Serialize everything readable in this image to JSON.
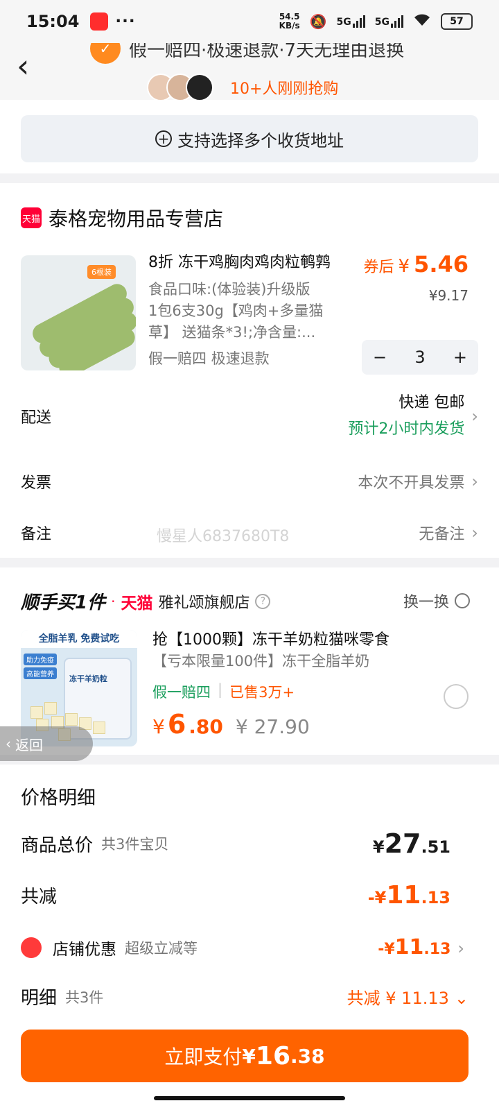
{
  "status_bar": {
    "time": "15:04",
    "speed_value": "54.5",
    "speed_unit": "KB/s",
    "net1": "5G",
    "net2": "5G",
    "battery": "57"
  },
  "header": {
    "guarantee_text": "假一赔四·极速退款·7天无理由退换",
    "buyers_text": "10+人刚刚抢购"
  },
  "address": {
    "multi_address_label": "支持选择多个收货地址"
  },
  "shop1": {
    "badge": "天猫",
    "name": "泰格宠物用品专营店",
    "product": {
      "thumb_tag": "6根装",
      "title": "8折 冻干鸡胸肉鸡肉粒鹌鹑",
      "desc_line1": "食品口味:(体验装)升级版",
      "desc_line2": "1包6支30g【鸡肉+多量猫",
      "desc_line3": "草】  送猫条*3!;净含量:...",
      "tags": "假一赔四  极速退款",
      "after_coupon_label": "券后",
      "currency": "¥",
      "after_coupon_price": "5.46",
      "original_price": "¥9.17",
      "quantity": "3",
      "minus": "−",
      "plus": "+"
    },
    "delivery": {
      "label": "配送",
      "method": "快递 包邮",
      "eta": "预计2小时内发货"
    },
    "invoice": {
      "label": "发票",
      "value": "本次不开具发票"
    },
    "remark": {
      "label": "备注",
      "value": "无备注"
    },
    "watermark": "慢星人6837680T8"
  },
  "shop2": {
    "brand": "顺手买1件",
    "dot": "·",
    "tmall": "天猫",
    "name": "雅礼颂旗舰店",
    "swap_label": "换一换",
    "product": {
      "thumb_top": "全脂羊乳 免费试吃",
      "thumb_tag1": "助力免疫",
      "thumb_tag2": "高能营养",
      "thumb_label": "冻干羊奶粒",
      "title": "抢【1000颗】冻干羊奶粒猫咪零食",
      "subtitle": "【亏本限量100件】冻干全脂羊奶",
      "tag1": "假一赔四",
      "tag2": "已售3万+",
      "currency": "¥",
      "price_int": "6",
      "price_dec": ".80",
      "original_price": "¥ 27.90"
    }
  },
  "return_tab": "返回",
  "price_detail": {
    "title": "价格明细",
    "total_label": "商品总价",
    "total_sub": "共3件宝贝",
    "total_currency": "¥",
    "total_int": "27",
    "total_dec": ".51",
    "reduce_label": "共减",
    "reduce_prefix": "-¥",
    "reduce_int": "11",
    "reduce_dec": ".13",
    "shop_discount_label": "店铺优惠",
    "shop_discount_sub": "超级立减等",
    "shop_discount_prefix": "-¥",
    "shop_discount_int": "11",
    "shop_discount_dec": ".13",
    "detail_label": "明细",
    "detail_sub": "共3件",
    "detail_value": "共减 ¥ 11.13"
  },
  "pay": {
    "label": "立即支付",
    "currency": "¥",
    "int": "16",
    "dec": ".38"
  },
  "colors": {
    "accent": "#ff6300",
    "tmall": "#ff0036",
    "green": "#1a9e5c"
  }
}
